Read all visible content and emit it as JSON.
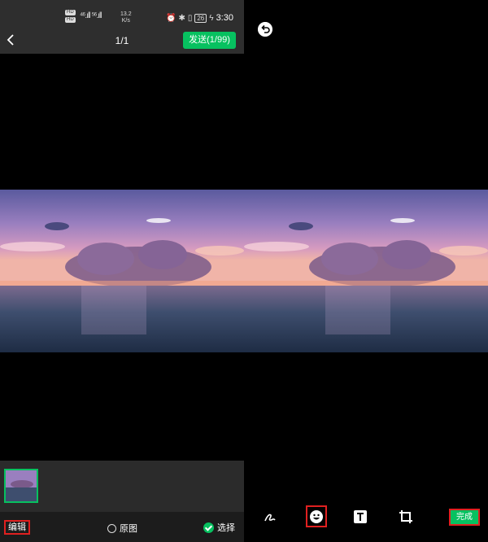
{
  "status_bar": {
    "hd1": "HD",
    "hd2": "HD",
    "signal": "⁴⁶.ıll ⁵⁶.ıll",
    "speed_value": "13.2",
    "speed_unit": "K/s",
    "battery": "26",
    "time": "3:30"
  },
  "header": {
    "page_count": "1/1",
    "send_label": "发送(1/99)"
  },
  "bottom": {
    "edit_label": "编辑",
    "original_label": "原图",
    "select_label": "选择"
  },
  "editor": {
    "done_label": "完成",
    "tools": [
      "pen-icon",
      "emoji-icon",
      "text-icon",
      "crop-icon"
    ]
  },
  "colors": {
    "accent": "#07c160",
    "highlight": "#e02020",
    "header_bg": "#2e2e2e"
  }
}
